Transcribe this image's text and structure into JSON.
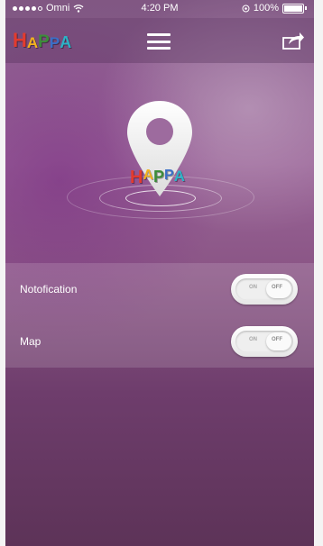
{
  "status_bar": {
    "carrier": "Omni",
    "time": "4:20 PM",
    "battery": "100%"
  },
  "nav": {
    "logo_text": "HAPPA",
    "menu_icon": "hamburger-menu-icon",
    "share_icon": "share-icon"
  },
  "hero": {
    "logo_text": "HAPPA"
  },
  "settings": {
    "rows": [
      {
        "label": "Notofication",
        "on_label": "ON",
        "off_label": "OFF",
        "state": "off"
      },
      {
        "label": "Map",
        "on_label": "ON",
        "off_label": "OFF",
        "state": "off"
      }
    ]
  },
  "colors": {
    "logo_h": "#e33b2e",
    "logo_a": "#f2b21e",
    "logo_p1": "#3d8c3a",
    "logo_p2": "#3b6fc7",
    "logo_a2": "#2bb3c7"
  }
}
